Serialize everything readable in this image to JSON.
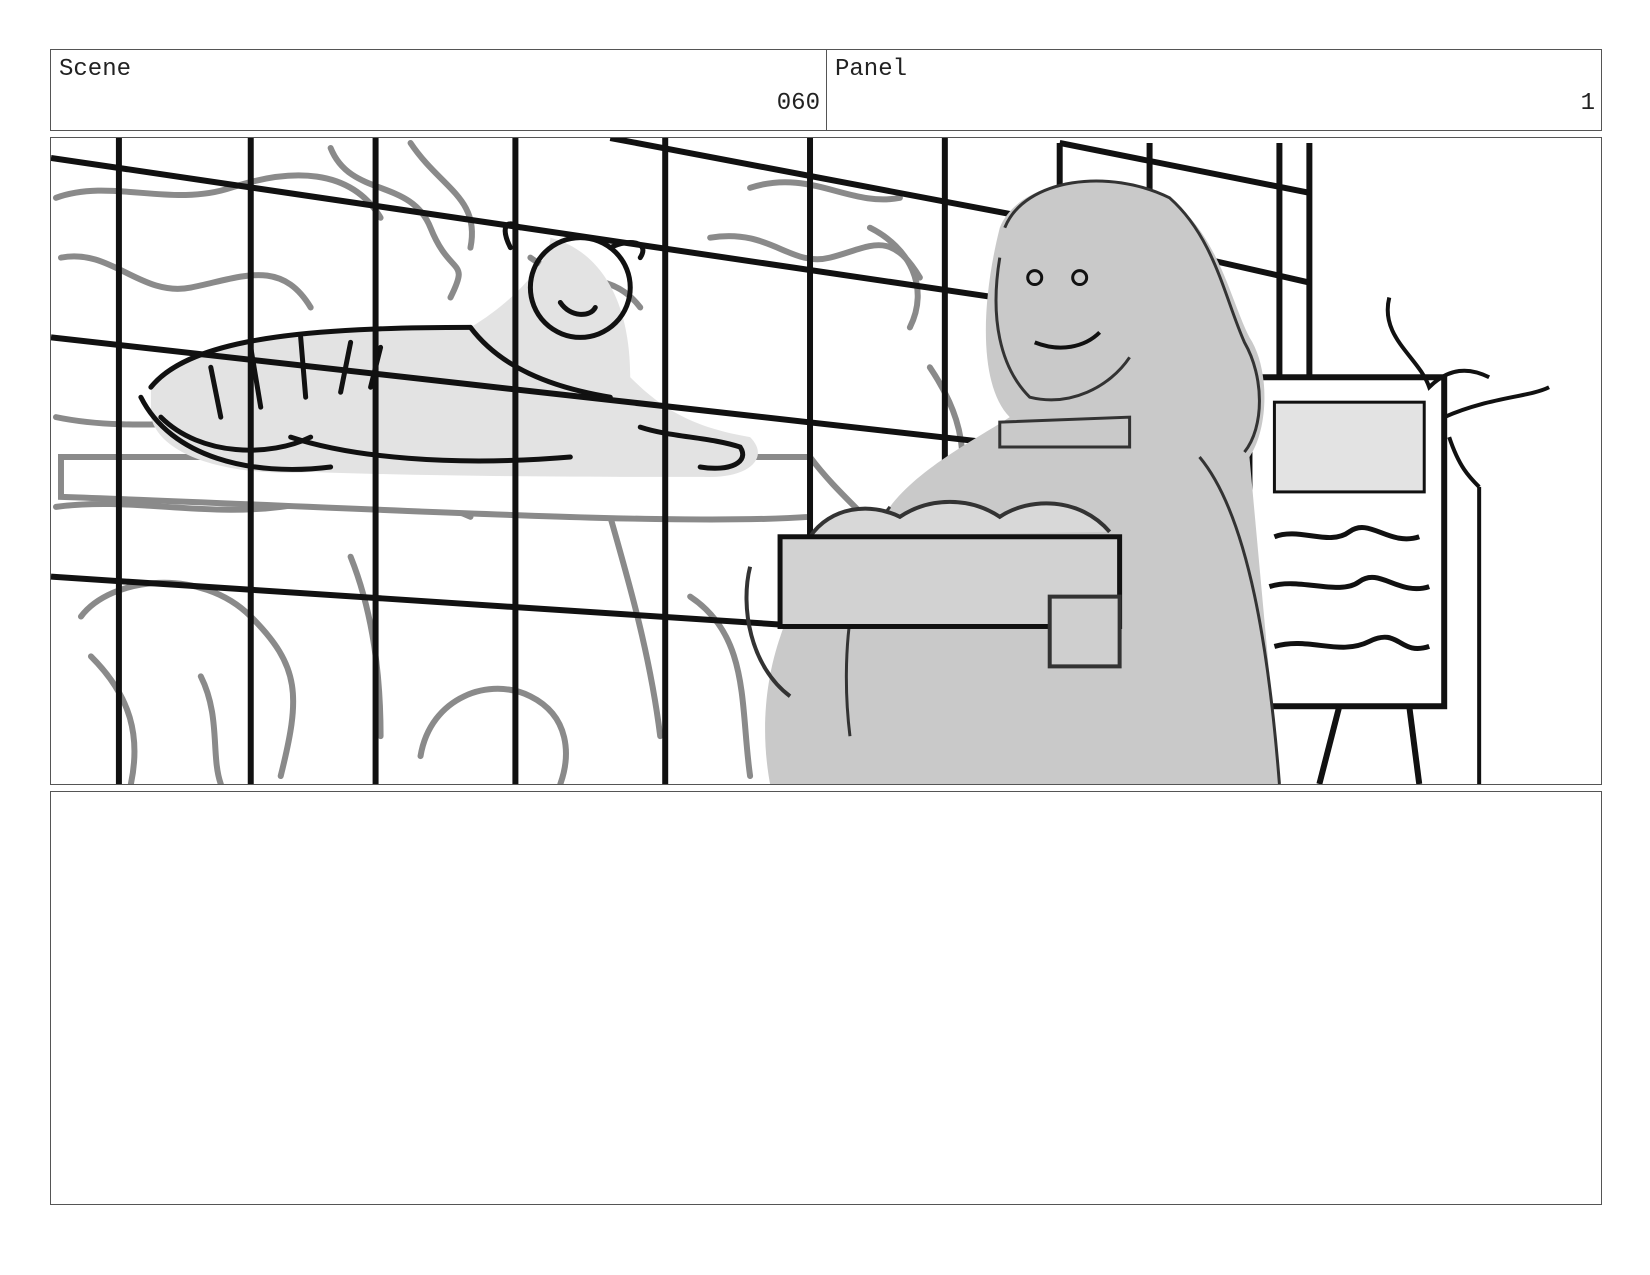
{
  "header": {
    "scene_label": "Scene",
    "scene_number": "060",
    "panel_label": "Panel",
    "panel_number": "1"
  },
  "frame": {
    "sketch_name": "storyboard-sketch",
    "colors": {
      "ink": "#111111",
      "gray_line": "#8a8a8a",
      "fill": "#c9c9c9",
      "light_fill": "#e3e3e3"
    }
  },
  "notes": {
    "text": ""
  }
}
